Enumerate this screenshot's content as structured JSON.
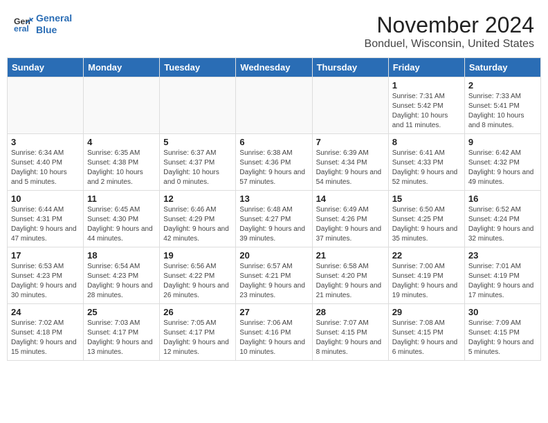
{
  "header": {
    "logo_line1": "General",
    "logo_line2": "Blue",
    "month_title": "November 2024",
    "location": "Bonduel, Wisconsin, United States"
  },
  "weekdays": [
    "Sunday",
    "Monday",
    "Tuesday",
    "Wednesday",
    "Thursday",
    "Friday",
    "Saturday"
  ],
  "weeks": [
    [
      {
        "day": "",
        "info": ""
      },
      {
        "day": "",
        "info": ""
      },
      {
        "day": "",
        "info": ""
      },
      {
        "day": "",
        "info": ""
      },
      {
        "day": "",
        "info": ""
      },
      {
        "day": "1",
        "info": "Sunrise: 7:31 AM\nSunset: 5:42 PM\nDaylight: 10 hours and 11 minutes."
      },
      {
        "day": "2",
        "info": "Sunrise: 7:33 AM\nSunset: 5:41 PM\nDaylight: 10 hours and 8 minutes."
      }
    ],
    [
      {
        "day": "3",
        "info": "Sunrise: 6:34 AM\nSunset: 4:40 PM\nDaylight: 10 hours and 5 minutes."
      },
      {
        "day": "4",
        "info": "Sunrise: 6:35 AM\nSunset: 4:38 PM\nDaylight: 10 hours and 2 minutes."
      },
      {
        "day": "5",
        "info": "Sunrise: 6:37 AM\nSunset: 4:37 PM\nDaylight: 10 hours and 0 minutes."
      },
      {
        "day": "6",
        "info": "Sunrise: 6:38 AM\nSunset: 4:36 PM\nDaylight: 9 hours and 57 minutes."
      },
      {
        "day": "7",
        "info": "Sunrise: 6:39 AM\nSunset: 4:34 PM\nDaylight: 9 hours and 54 minutes."
      },
      {
        "day": "8",
        "info": "Sunrise: 6:41 AM\nSunset: 4:33 PM\nDaylight: 9 hours and 52 minutes."
      },
      {
        "day": "9",
        "info": "Sunrise: 6:42 AM\nSunset: 4:32 PM\nDaylight: 9 hours and 49 minutes."
      }
    ],
    [
      {
        "day": "10",
        "info": "Sunrise: 6:44 AM\nSunset: 4:31 PM\nDaylight: 9 hours and 47 minutes."
      },
      {
        "day": "11",
        "info": "Sunrise: 6:45 AM\nSunset: 4:30 PM\nDaylight: 9 hours and 44 minutes."
      },
      {
        "day": "12",
        "info": "Sunrise: 6:46 AM\nSunset: 4:29 PM\nDaylight: 9 hours and 42 minutes."
      },
      {
        "day": "13",
        "info": "Sunrise: 6:48 AM\nSunset: 4:27 PM\nDaylight: 9 hours and 39 minutes."
      },
      {
        "day": "14",
        "info": "Sunrise: 6:49 AM\nSunset: 4:26 PM\nDaylight: 9 hours and 37 minutes."
      },
      {
        "day": "15",
        "info": "Sunrise: 6:50 AM\nSunset: 4:25 PM\nDaylight: 9 hours and 35 minutes."
      },
      {
        "day": "16",
        "info": "Sunrise: 6:52 AM\nSunset: 4:24 PM\nDaylight: 9 hours and 32 minutes."
      }
    ],
    [
      {
        "day": "17",
        "info": "Sunrise: 6:53 AM\nSunset: 4:23 PM\nDaylight: 9 hours and 30 minutes."
      },
      {
        "day": "18",
        "info": "Sunrise: 6:54 AM\nSunset: 4:23 PM\nDaylight: 9 hours and 28 minutes."
      },
      {
        "day": "19",
        "info": "Sunrise: 6:56 AM\nSunset: 4:22 PM\nDaylight: 9 hours and 26 minutes."
      },
      {
        "day": "20",
        "info": "Sunrise: 6:57 AM\nSunset: 4:21 PM\nDaylight: 9 hours and 23 minutes."
      },
      {
        "day": "21",
        "info": "Sunrise: 6:58 AM\nSunset: 4:20 PM\nDaylight: 9 hours and 21 minutes."
      },
      {
        "day": "22",
        "info": "Sunrise: 7:00 AM\nSunset: 4:19 PM\nDaylight: 9 hours and 19 minutes."
      },
      {
        "day": "23",
        "info": "Sunrise: 7:01 AM\nSunset: 4:19 PM\nDaylight: 9 hours and 17 minutes."
      }
    ],
    [
      {
        "day": "24",
        "info": "Sunrise: 7:02 AM\nSunset: 4:18 PM\nDaylight: 9 hours and 15 minutes."
      },
      {
        "day": "25",
        "info": "Sunrise: 7:03 AM\nSunset: 4:17 PM\nDaylight: 9 hours and 13 minutes."
      },
      {
        "day": "26",
        "info": "Sunrise: 7:05 AM\nSunset: 4:17 PM\nDaylight: 9 hours and 12 minutes."
      },
      {
        "day": "27",
        "info": "Sunrise: 7:06 AM\nSunset: 4:16 PM\nDaylight: 9 hours and 10 minutes."
      },
      {
        "day": "28",
        "info": "Sunrise: 7:07 AM\nSunset: 4:15 PM\nDaylight: 9 hours and 8 minutes."
      },
      {
        "day": "29",
        "info": "Sunrise: 7:08 AM\nSunset: 4:15 PM\nDaylight: 9 hours and 6 minutes."
      },
      {
        "day": "30",
        "info": "Sunrise: 7:09 AM\nSunset: 4:15 PM\nDaylight: 9 hours and 5 minutes."
      }
    ]
  ]
}
